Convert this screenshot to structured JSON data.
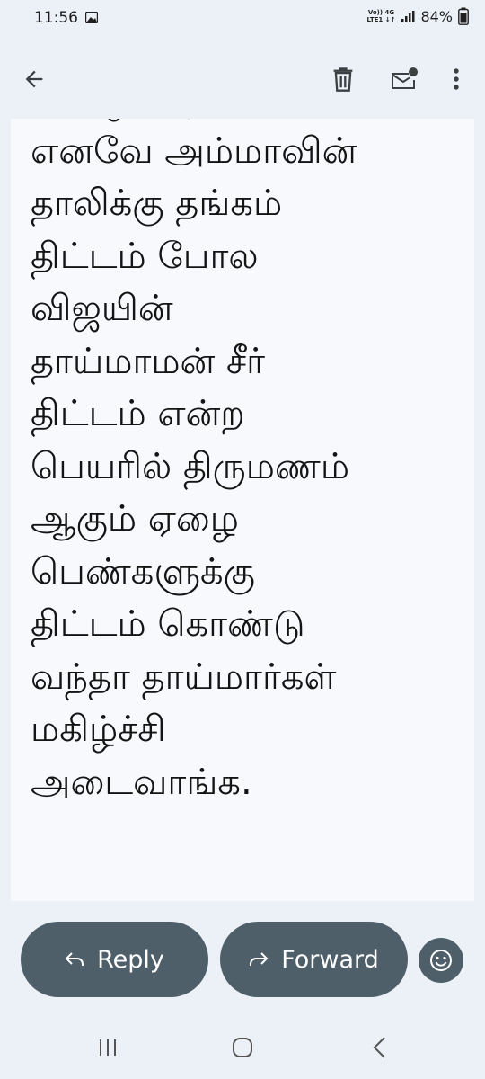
{
  "status_bar": {
    "time": "11:56",
    "network_top": "Vo)) 4G",
    "network_bottom": "LTE1 ↓↑",
    "battery": "84%"
  },
  "app_bar": {
    "back_icon": "arrow-left-icon",
    "delete_icon": "trash-icon",
    "mark_unread_icon": "mail-unread-icon",
    "more_icon": "more-vertical-icon"
  },
  "email": {
    "body_lines": [
      "அழைக்கிறார்கள்.",
      "எனவே அம்மாவின்",
      "தாலிக்கு தங்கம்",
      "திட்டம் போல",
      "விஜயின்",
      "தாய்மாமன் சீர்",
      "திட்டம் என்ற",
      "பெயரில் திருமணம்",
      "ஆகும் ஏழை",
      "பெண்களுக்கு",
      "திட்டம் கொண்டு",
      "வந்தா தாய்மார்கள்",
      "மகிழ்ச்சி",
      "அடைவாங்க."
    ]
  },
  "actions": {
    "reply_label": "Reply",
    "forward_label": "Forward",
    "emoji_icon": "smiley-icon"
  },
  "nav": {
    "recents_icon": "recents-icon",
    "home_icon": "home-icon",
    "back_icon": "nav-back-icon"
  },
  "colors": {
    "background": "#ecf1f8",
    "content_bg": "#f7f9fd",
    "button_bg": "#4f5f6a",
    "button_text": "#ffffff"
  }
}
